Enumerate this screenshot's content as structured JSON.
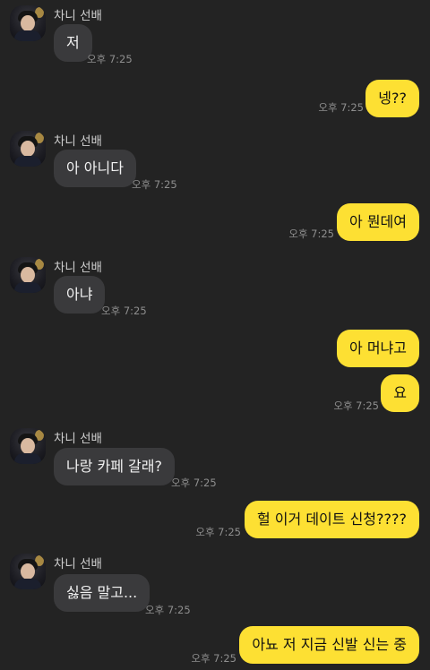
{
  "sender_name": "차니 선배",
  "messages": [
    {
      "text": "저",
      "time": "오후 7:25"
    },
    {
      "text": "넹??",
      "time": "오후 7:25"
    },
    {
      "text": "아 아니다",
      "time": "오후 7:25"
    },
    {
      "text": "아 뭔데여",
      "time": "오후 7:25"
    },
    {
      "text": "아냐",
      "time": "오후 7:25"
    },
    {
      "text": "아 머냐고",
      "time": ""
    },
    {
      "text": "요",
      "time": "오후 7:25"
    },
    {
      "text": "나랑 카페 갈래?",
      "time": "오후 7:25"
    },
    {
      "text": "헐 이거 데이트 신청????",
      "time": "오후 7:25"
    },
    {
      "text": "싫음 말고...",
      "time": "오후 7:25"
    },
    {
      "text": "아뇨 저 지금 신발 신는 중",
      "time": "오후 7:25"
    }
  ],
  "colors": {
    "background": "#232323",
    "incoming_bubble": "#3a3a3c",
    "outgoing_bubble": "#fde033"
  }
}
